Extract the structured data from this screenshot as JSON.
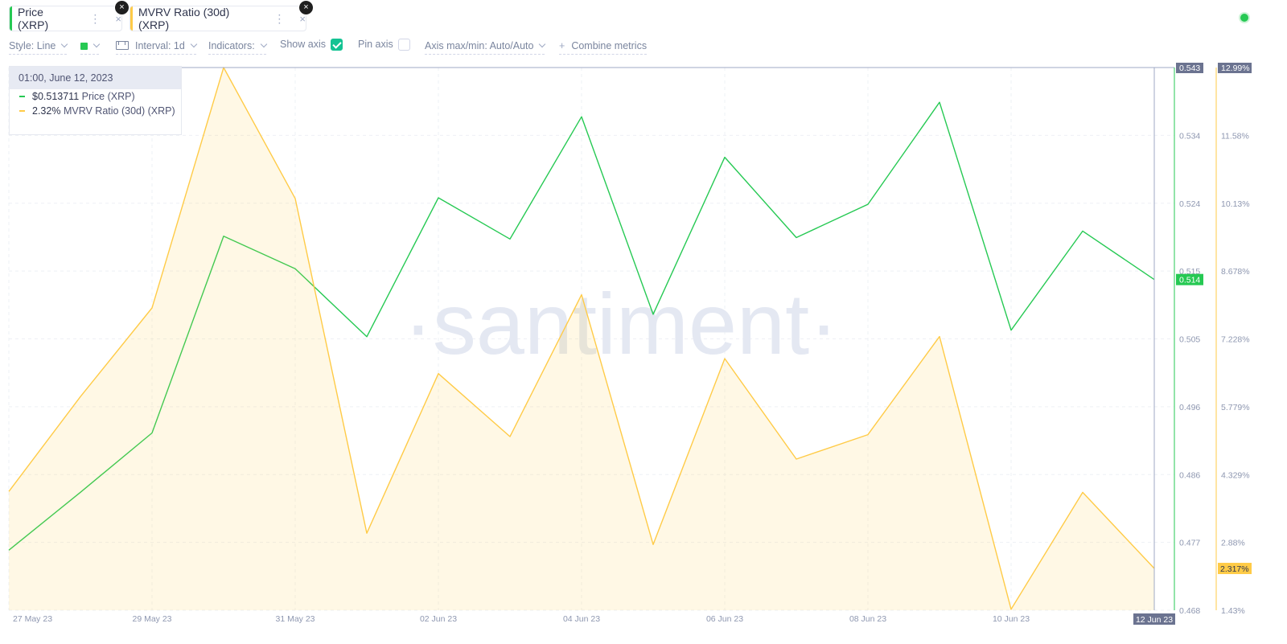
{
  "metrics": [
    {
      "label": "Price (XRP)",
      "color": "#26c953",
      "remove": "×",
      "close": "×",
      "menu": "⋮"
    },
    {
      "label": "MVRV Ratio (30d) (XRP)",
      "color": "#ffcb47",
      "remove": "×",
      "close": "×",
      "menu": "⋮"
    }
  ],
  "toolbar": {
    "style": "Style: Line",
    "interval": "Interval: 1d",
    "indicators": "Indicators:",
    "show_axis": "Show axis",
    "show_axis_checked": true,
    "pin_axis": "Pin axis",
    "pin_axis_checked": false,
    "axis_maxmin": "Axis max/min: Auto/Auto",
    "combine": "Combine metrics"
  },
  "tooltip": {
    "date": "01:00, June 12, 2023",
    "rows": [
      {
        "value": "$0.513711",
        "label": "Price (XRP)",
        "color": "#26c953"
      },
      {
        "value": "2.32%",
        "label": "MVRV Ratio (30d) (XRP)",
        "color": "#ffcb47"
      }
    ]
  },
  "chart_data": {
    "type": "line",
    "watermark": "·santiment·",
    "x": [
      "27 May 23",
      "28 May 23",
      "29 May 23",
      "30 May 23",
      "31 May 23",
      "01 Jun 23",
      "02 Jun 23",
      "03 Jun 23",
      "04 Jun 23",
      "05 Jun 23",
      "06 Jun 23",
      "07 Jun 23",
      "08 Jun 23",
      "09 Jun 23",
      "10 Jun 23",
      "11 Jun 23",
      "12 Jun 23"
    ],
    "x_tick_labels": [
      "27 May 23",
      "29 May 23",
      "31 May 23",
      "02 Jun 23",
      "04 Jun 23",
      "06 Jun 23",
      "08 Jun 23",
      "10 Jun 23"
    ],
    "crosshair_label": "12 Jun 23",
    "series": [
      {
        "name": "Price (XRP)",
        "color": "#26c953",
        "axis": "left",
        "values": [
          0.4763,
          0.4843,
          0.4925,
          0.5197,
          0.5152,
          0.5058,
          0.525,
          0.5193,
          0.5362,
          0.5089,
          0.5306,
          0.5195,
          0.5241,
          0.5382,
          0.5067,
          0.5204,
          0.5137
        ]
      },
      {
        "name": "MVRV Ratio (30d) (XRP)",
        "color": "#ffcb47",
        "axis": "right",
        "area": true,
        "values": [
          3.96,
          5.98,
          7.87,
          12.99,
          10.2,
          3.07,
          6.47,
          5.13,
          8.15,
          2.83,
          6.79,
          4.65,
          5.17,
          7.26,
          1.45,
          3.94,
          2.32
        ]
      }
    ],
    "y_left": {
      "range": [
        0.468,
        0.543
      ],
      "ticks": [
        "0.468",
        "0.477",
        "0.486",
        "0.496",
        "0.505",
        "0.515",
        "0.524",
        "0.534",
        "0.543"
      ],
      "current": "0.514"
    },
    "y_right": {
      "range": [
        1.43,
        12.99
      ],
      "ticks": [
        "1.43%",
        "2.88%",
        "4.329%",
        "5.779%",
        "7.228%",
        "8.678%",
        "10.13%",
        "11.58%",
        "12.99%"
      ],
      "current": "2.317%"
    }
  }
}
